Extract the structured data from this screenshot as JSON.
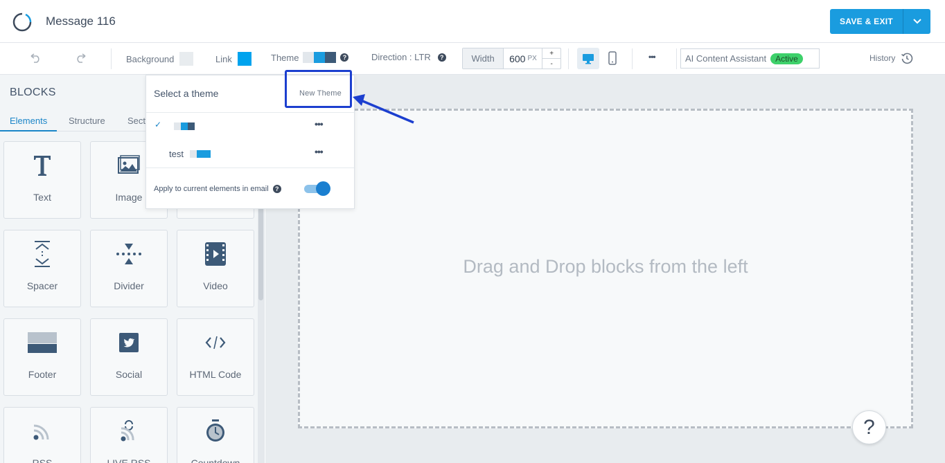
{
  "header": {
    "title": "Message 116",
    "save_label": "SAVE & EXIT"
  },
  "toolbar": {
    "background_label": "Background",
    "link_label": "Link",
    "theme_label": "Theme",
    "direction_label": "Direction : LTR",
    "width_label": "Width",
    "width_value": "600",
    "width_unit": "PX",
    "stepper_up": "+",
    "stepper_down": "-",
    "more_label": "•••",
    "ai_label": "AI Content Assistant",
    "ai_status": "Active",
    "history_label": "History",
    "help_glyph": "?",
    "colors": {
      "background_swatch": "#e8ecef",
      "link_swatch": "#00a3ee",
      "accent": "#1a9cdf"
    }
  },
  "sidebar": {
    "title": "BLOCKS",
    "tabs": [
      "Elements",
      "Structure",
      "Sect"
    ],
    "tiles": [
      {
        "label": "Text",
        "icon": "text-icon"
      },
      {
        "label": "Image",
        "icon": "image-icon"
      },
      {
        "label": "Spacer",
        "icon": "spacer-icon"
      },
      {
        "label": "Divider",
        "icon": "divider-icon"
      },
      {
        "label": "Video",
        "icon": "video-icon"
      },
      {
        "label": "Footer",
        "icon": "footer-icon"
      },
      {
        "label": "Social",
        "icon": "twitter-icon"
      },
      {
        "label": "HTML Code",
        "icon": "code-icon"
      },
      {
        "label": "RSS",
        "icon": "rss-icon"
      },
      {
        "label": "LIVE RSS",
        "icon": "live-rss-icon"
      },
      {
        "label": "Countdown",
        "icon": "timer-icon"
      }
    ]
  },
  "popover": {
    "title": "Select a theme",
    "new_theme": "New Theme",
    "check": "✓",
    "more": "•••",
    "themes": [
      {
        "name": "",
        "selected": true
      },
      {
        "name": "test",
        "selected": false
      }
    ],
    "apply_label": "Apply to current elements in email",
    "apply_enabled": true
  },
  "canvas": {
    "placeholder": "Drag and Drop blocks from the left",
    "help_button": "?"
  }
}
